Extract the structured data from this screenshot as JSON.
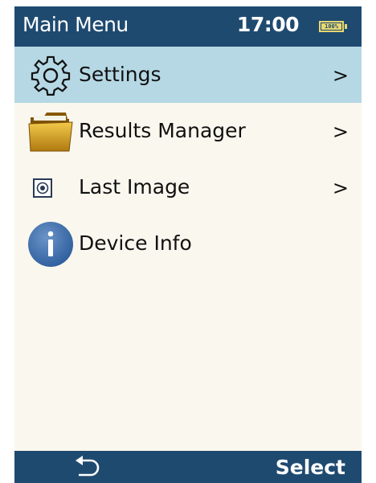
{
  "header": {
    "title": "Main Menu",
    "time": "17:00",
    "battery_text": "100%",
    "battery_level": 1.0
  },
  "menu": {
    "items": [
      {
        "label": "Settings",
        "icon": "gear-icon",
        "chevron": ">",
        "selected": true
      },
      {
        "label": "Results Manager",
        "icon": "folder-icon",
        "chevron": ">",
        "selected": false
      },
      {
        "label": "Last Image",
        "icon": "image-target-icon",
        "chevron": ">",
        "selected": false
      },
      {
        "label": "Device Info",
        "icon": "info-icon",
        "chevron": "",
        "selected": false
      }
    ]
  },
  "footer": {
    "back_icon": "back-arrow-icon",
    "select_label": "Select"
  },
  "colors": {
    "bar": "#1f4a70",
    "selected_row": "#b5d8e4",
    "background": "#faf7ee",
    "battery": "#e8d870"
  }
}
